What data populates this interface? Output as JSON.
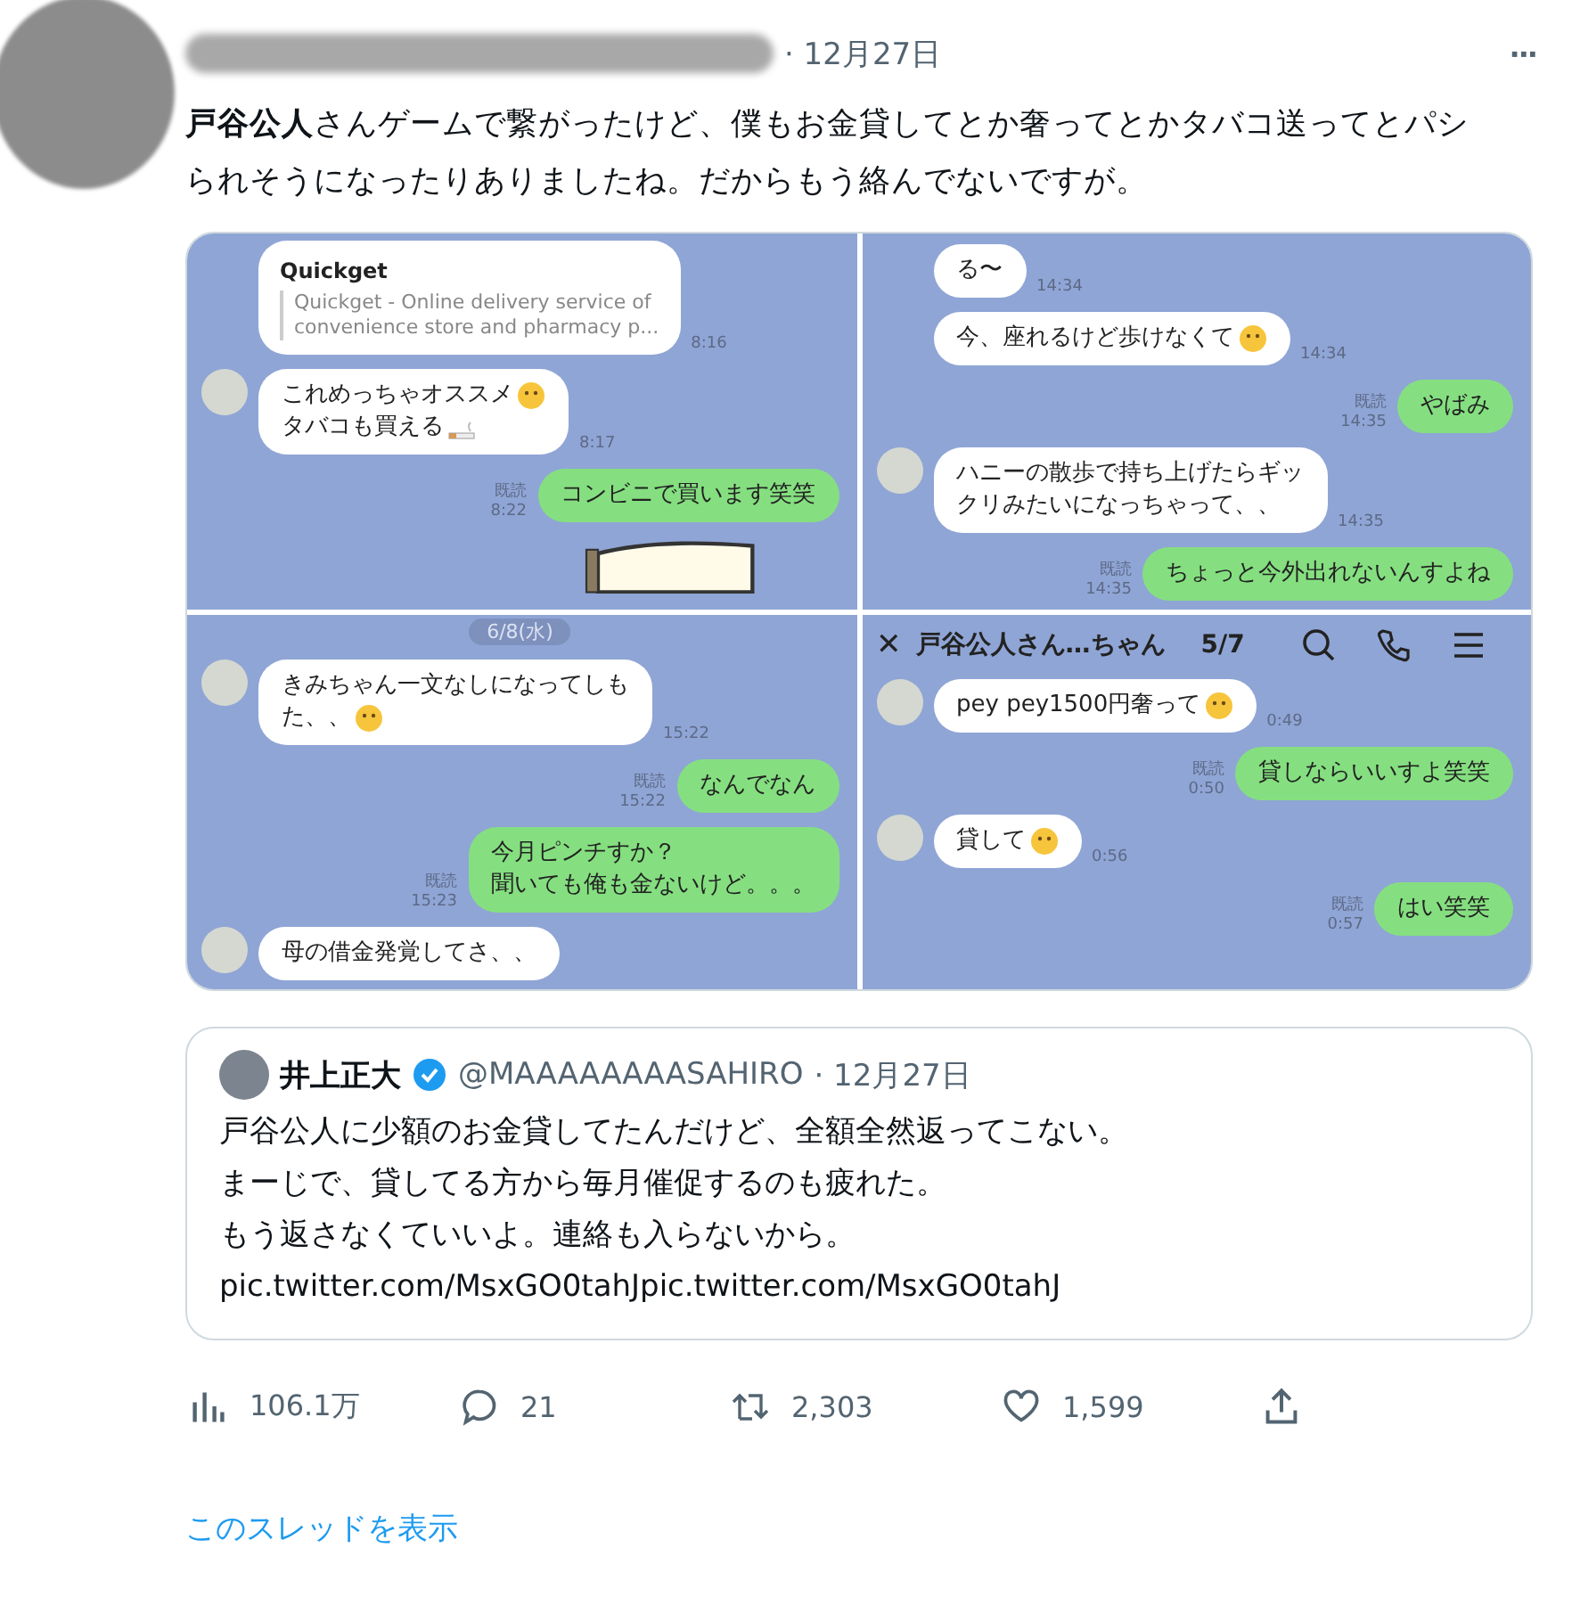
{
  "tweet": {
    "date": "· 12月27日",
    "more": "···",
    "text": "**戸谷公人**さんゲームで繋がったけど、僕もお金貸してとか奢ってとかタバコ送ってとパシられそうになったりありましたね。だからもう絡んでないですが。"
  },
  "panels": [
    {
      "messages": [
        {
          "kind": "card",
          "avatar": false,
          "title": "Quickget",
          "lines": [
            {
              "text": "Quickget - Online delivery service of"
            },
            {
              "text": "convenience store and pharmacy p..."
            }
          ],
          "time": "8:16"
        },
        {
          "kind": "in",
          "avatar": true,
          "lines": [
            {
              "text": "これめっちゃオススメ",
              "emoji": {
                "kind": "face"
              }
            },
            {
              "text": "タバコも買える",
              "emoji": {
                "kind": "cigarette"
              }
            }
          ],
          "time": "8:17"
        },
        {
          "kind": "out",
          "lines": [
            {
              "text": "コンビニで買います笑笑"
            }
          ],
          "read": "既読",
          "time": "8:22"
        },
        {
          "kind": "sticker"
        }
      ]
    },
    {
      "messages": [
        {
          "kind": "in",
          "avatar": false,
          "lines": [
            {
              "text": "る〜"
            }
          ],
          "time": "14:34"
        },
        {
          "kind": "in",
          "avatar": false,
          "lines": [
            {
              "text": "今、座れるけど歩けなくて",
              "emoji": {
                "kind": "face"
              }
            }
          ],
          "time": "14:34"
        },
        {
          "kind": "out",
          "lines": [
            {
              "text": "やばみ"
            }
          ],
          "read": "既読",
          "time": "14:35"
        },
        {
          "kind": "in",
          "avatar": true,
          "lines": [
            {
              "text": "ハニーの散歩で持ち上げたらギッ"
            },
            {
              "text": "クリみたいになっちゃって、、"
            }
          ],
          "time": "14:35"
        },
        {
          "kind": "out",
          "lines": [
            {
              "text": "ちょっと今外出れないんすよね"
            }
          ],
          "read": "既読",
          "time": "14:35"
        }
      ]
    },
    {
      "messages": [
        {
          "kind": "date",
          "text": "6/8(水)"
        },
        {
          "kind": "in",
          "avatar": true,
          "lines": [
            {
              "text": "きみちゃん一文なしになってしも"
            },
            {
              "text": "た、、",
              "emoji": {
                "kind": "face"
              }
            }
          ],
          "time": "15:22"
        },
        {
          "kind": "out",
          "lines": [
            {
              "text": "なんでなん"
            }
          ],
          "read": "既読",
          "time": "15:22"
        },
        {
          "kind": "out",
          "lines": [
            {
              "text": "今月ピンチすか？"
            },
            {
              "text": "聞いても俺も金ないけど。。。"
            }
          ],
          "read": "既読",
          "time": "15:23"
        },
        {
          "kind": "in",
          "avatar": true,
          "lines": [
            {
              "text": "母の借金発覚してさ、、"
            }
          ]
        }
      ]
    },
    {
      "header": {
        "close": "✕",
        "title": "戸谷公人さん…ちゃん",
        "page": "5/7"
      },
      "messages": [
        {
          "kind": "in",
          "avatar": true,
          "lines": [
            {
              "text": "pey pey1500円奢って",
              "emoji": {
                "kind": "face"
              }
            }
          ],
          "time": "0:49"
        },
        {
          "kind": "out",
          "lines": [
            {
              "text": "貸しならいいすよ笑笑"
            }
          ],
          "read": "既読",
          "time": "0:50"
        },
        {
          "kind": "in",
          "avatar": true,
          "lines": [
            {
              "text": "貸して",
              "emoji": {
                "kind": "face"
              }
            }
          ],
          "time": "0:56"
        },
        {
          "kind": "out",
          "lines": [
            {
              "text": "はい笑笑"
            }
          ],
          "read": "既読",
          "time": "0:57"
        }
      ]
    }
  ],
  "quote": {
    "name": "井上正大",
    "verified": true,
    "handle": "@MAAAAAAAASAHIRO",
    "date": "· 12月27日",
    "lines": [
      "戸谷公人に少額のお金貸してたんだけど、全額全然返ってこない。",
      "まーじで、貸してる方から毎月催促するのも疲れた。",
      "もう返さなくていいよ。連絡も入らないから。",
      "pic.twitter.com/MsxGO0tahJpic.twitter.com/MsxGO0tahJ"
    ]
  },
  "actions": [
    {
      "kind": "views",
      "count": "106.1万"
    },
    {
      "kind": "reply",
      "count": "21"
    },
    {
      "kind": "retweet",
      "count": "2,303"
    },
    {
      "kind": "like",
      "count": "1,599"
    },
    {
      "kind": "share"
    }
  ],
  "thread_link": "このスレッドを表示"
}
